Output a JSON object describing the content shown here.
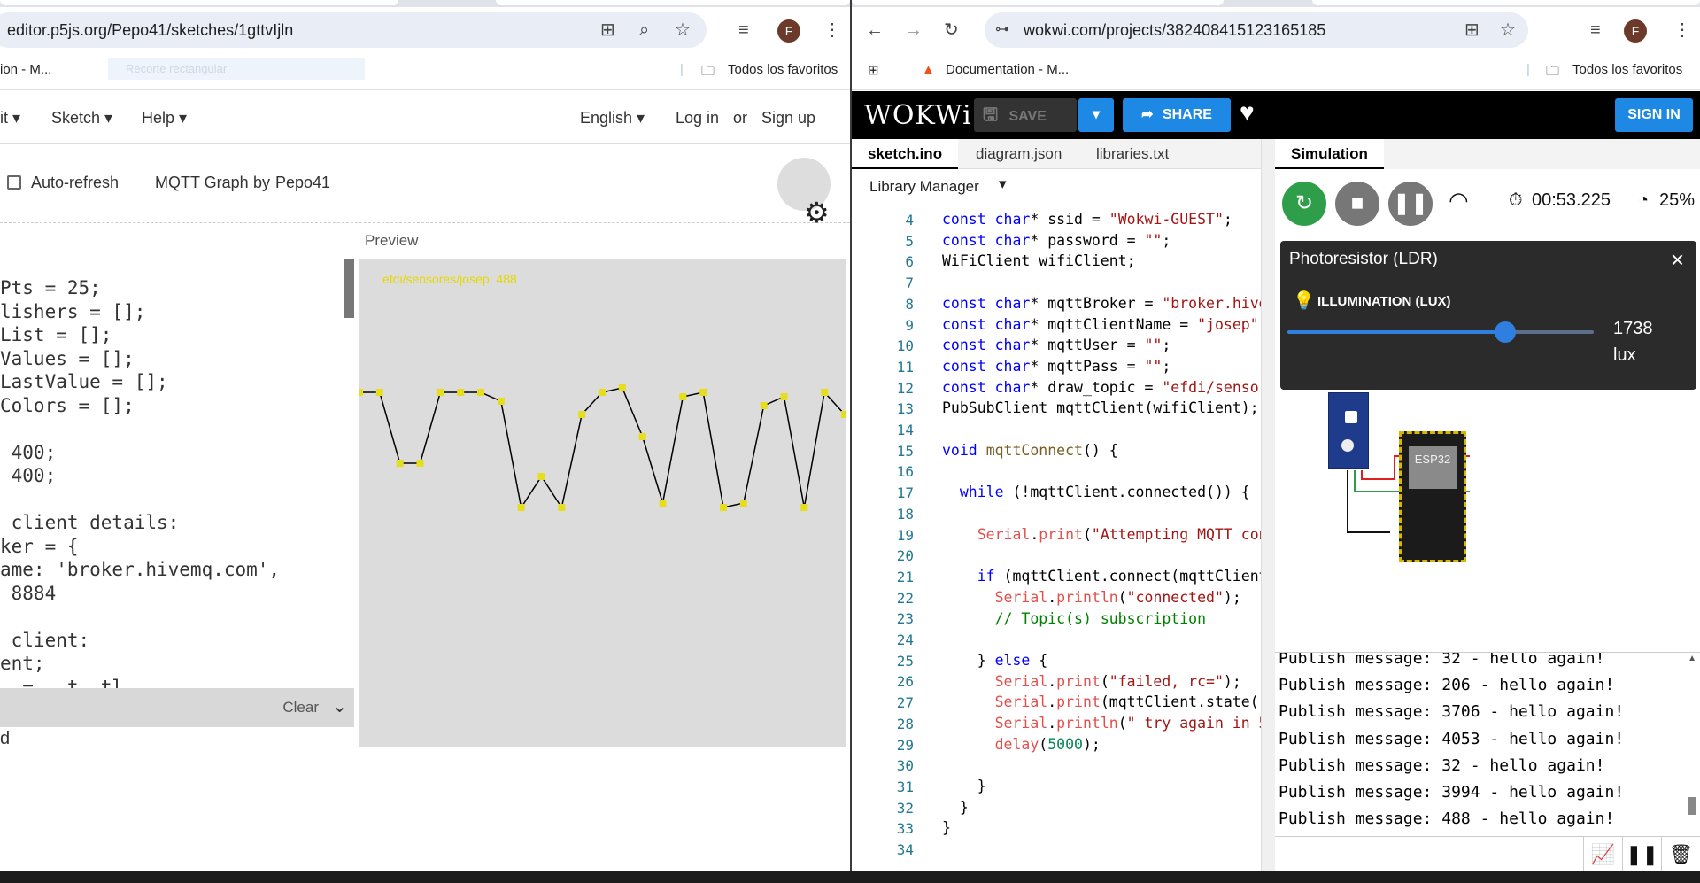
{
  "left_browser": {
    "url": "editor.p5js.org/Pepo41/sketches/1gttvIjln",
    "bookmark_1": "ion - M...",
    "bookmark_faded": "Recorte rectangular",
    "all_bookmarks": "Todos los favoritos",
    "avatar_letter": "F"
  },
  "p5": {
    "menu_edit": "it",
    "menu_sketch": "Sketch",
    "menu_help": "Help",
    "language": "English",
    "login": "Log in",
    "or": "or",
    "signup": "Sign up",
    "auto_refresh": "Auto-refresh",
    "sketch_name": "MQTT Graph",
    "by": "by",
    "author": "Pepo41",
    "preview_label": "Preview",
    "preview_topic": "efdi/sensores/josep: 488",
    "console_clear": "Clear",
    "console_text": "d",
    "code_lines": [
      "Pts = 25;",
      "lishers = [];",
      "List = [];",
      "Values = [];",
      "LastValue = [];",
      "Colors = [];",
      "",
      " 400;",
      " 400;",
      "",
      " client details:",
      "ker = {",
      "ame: 'broker.hivemq.com',",
      " 8884",
      "",
      " client:",
      "ent;",
      "  = ..t..tl"
    ]
  },
  "chart_data": {
    "type": "line",
    "title": "",
    "series": [
      {
        "values": [
          400,
          400,
          320,
          320,
          400,
          400,
          400,
          390,
          270,
          305,
          270,
          375,
          400,
          405,
          350,
          275,
          395,
          400,
          270,
          275,
          385,
          395,
          270,
          400,
          375
        ]
      }
    ],
    "ylim": [
      0,
      550
    ]
  },
  "right_browser": {
    "url": "wokwi.com/projects/382408415123165185",
    "bookmark_1": "Documentation - M...",
    "all_bookmarks": "Todos los favoritos",
    "avatar_letter": "F"
  },
  "wokwi": {
    "logo": "WOKWi",
    "save": "SAVE",
    "share": "SHARE",
    "signin": "SIGN IN",
    "tabs": [
      "sketch.ino",
      "diagram.json",
      "libraries.txt"
    ],
    "library_manager": "Library Manager",
    "sim_tab": "Simulation",
    "timer": "00:53.225",
    "speed": "25%",
    "popup_title": "Photoresistor (LDR)",
    "popup_label": "ILLUMINATION (LUX)",
    "popup_value": "1738",
    "popup_unit": "lux",
    "illumination_fraction": 0.71,
    "esp_label": "ESP32",
    "line_numbers": [
      4,
      5,
      6,
      7,
      8,
      9,
      10,
      11,
      12,
      13,
      14,
      15,
      16,
      17,
      18,
      19,
      20,
      21,
      22,
      23,
      24,
      25,
      26,
      27,
      28,
      29,
      30,
      31,
      32,
      33,
      34
    ],
    "serial_lines": [
      "Publish message: 32 - hello again!",
      "Publish message: 206 - hello again!",
      "Publish message: 3706 - hello again!",
      "Publish message: 4053 - hello again!",
      "Publish message: 32 - hello again!",
      "Publish message: 3994 - hello again!",
      "Publish message: 488 - hello again!"
    ]
  }
}
